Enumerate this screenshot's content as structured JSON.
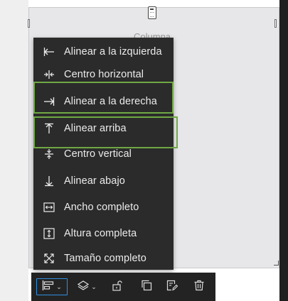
{
  "canvas": {
    "column_label": "Columna"
  },
  "menu": {
    "items": [
      {
        "label": "Alinear a la izquierda",
        "icon": "align-left-icon"
      },
      {
        "label": "Centro horizontal",
        "icon": "center-horizontal-icon"
      },
      {
        "label": "Alinear a la derecha",
        "icon": "align-right-icon"
      },
      {
        "label": "Alinear arriba",
        "icon": "align-top-icon"
      },
      {
        "label": "Centro vertical",
        "icon": "center-vertical-icon"
      },
      {
        "label": "Alinear abajo",
        "icon": "align-bottom-icon"
      },
      {
        "label": "Ancho completo",
        "icon": "full-width-icon"
      },
      {
        "label": "Altura completa",
        "icon": "full-height-icon"
      },
      {
        "label": "Tamaño completo",
        "icon": "full-size-icon"
      }
    ],
    "highlighted": [
      "Alinear a la derecha",
      "Alinear arriba"
    ]
  },
  "toolbar": {
    "buttons": [
      {
        "icon": "align-menu-icon",
        "has_dropdown": true,
        "active": true
      },
      {
        "icon": "layers-icon",
        "has_dropdown": true,
        "active": false
      },
      {
        "icon": "unlock-icon",
        "has_dropdown": false,
        "active": false
      },
      {
        "icon": "duplicate-icon",
        "has_dropdown": false,
        "active": false
      },
      {
        "icon": "edit-copy-icon",
        "has_dropdown": false,
        "active": false
      },
      {
        "icon": "trash-icon",
        "has_dropdown": false,
        "active": false
      }
    ]
  },
  "colors": {
    "menu_bg": "#2b2b2b",
    "menu_text": "#ececec",
    "highlight": "#70a844",
    "toolbar_bg": "#232323",
    "active_button_border": "#2f8fe0",
    "canvas_bg": "#e7e7e9"
  }
}
